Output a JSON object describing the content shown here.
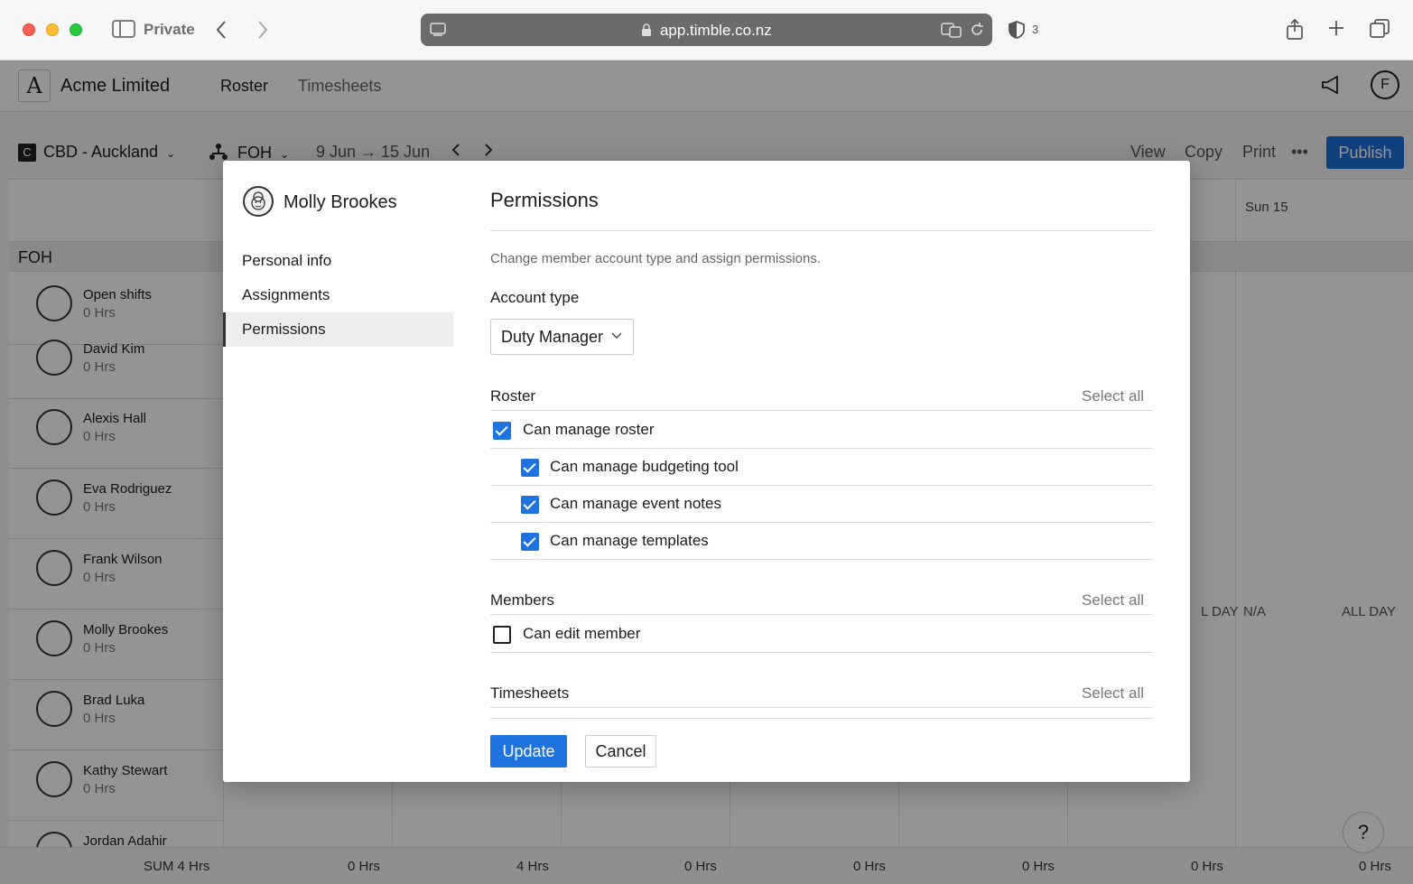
{
  "browser": {
    "mode_label": "Private",
    "url": "app.timble.co.nz",
    "shield_count": "3"
  },
  "app": {
    "company": "Acme Limited",
    "logo_letter": "A",
    "nav": [
      "Roster",
      "Timesheets"
    ],
    "user_initial": "F",
    "location_badge": "C",
    "location": "CBD - Auckland",
    "team": "FOH",
    "date_range": "9 Jun → 15 Jun",
    "actions": [
      "View",
      "Copy",
      "Print"
    ],
    "publish_label": "Publish",
    "day_header": "Sun 15",
    "group": "FOH",
    "people": [
      {
        "name": "Open shifts",
        "hours": "0 Hrs"
      },
      {
        "name": "David Kim",
        "hours": "0 Hrs"
      },
      {
        "name": "Alexis Hall",
        "hours": "0 Hrs"
      },
      {
        "name": "Eva Rodriguez",
        "hours": "0 Hrs"
      },
      {
        "name": "Frank Wilson",
        "hours": "0 Hrs"
      },
      {
        "name": "Molly Brookes",
        "hours": "0 Hrs"
      },
      {
        "name": "Brad Luka",
        "hours": "0 Hrs"
      },
      {
        "name": "Kathy Stewart",
        "hours": "0 Hrs"
      },
      {
        "name": "Jordan Adahir",
        "hours": ""
      }
    ],
    "allday_labels": [
      "L DAY",
      "N/A",
      "ALL DAY"
    ],
    "footer": {
      "sum_label": "SUM 4 Hrs",
      "totals": [
        "0 Hrs",
        "4 Hrs",
        "0 Hrs",
        "0 Hrs",
        "0 Hrs",
        "0 Hrs",
        "0 Hrs"
      ]
    },
    "help_label": "?"
  },
  "modal": {
    "member_name": "Molly Brookes",
    "menu": [
      "Personal info",
      "Assignments",
      "Permissions"
    ],
    "title": "Permissions",
    "description": "Change member account type and assign permissions.",
    "account_type_label": "Account type",
    "account_type_value": "Duty Manager",
    "select_all_label": "Select all",
    "sections": {
      "roster": "Roster",
      "members": "Members",
      "timesheets": "Timesheets"
    },
    "permissions": {
      "manage_roster": {
        "label": "Can manage roster",
        "checked": true
      },
      "budgeting_tool": {
        "label": "Can manage budgeting tool",
        "checked": true
      },
      "event_notes": {
        "label": "Can manage event notes",
        "checked": true
      },
      "templates": {
        "label": "Can manage templates",
        "checked": true
      },
      "edit_member": {
        "label": "Can edit member",
        "checked": false
      }
    },
    "update_label": "Update",
    "cancel_label": "Cancel"
  },
  "colors": {
    "accent": "#1e73e0",
    "publish": "#1c6fd8"
  }
}
